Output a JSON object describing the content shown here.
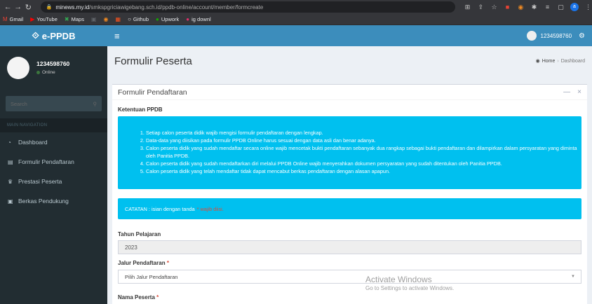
{
  "browser": {
    "url_host": "minews.my.id",
    "url_path": "/smkspgriciawigebang.sch.id/ppdb-online/account/member/formcreate",
    "bookmarks": [
      {
        "label": "Gmail",
        "icon": "M",
        "color": "#ea4335"
      },
      {
        "label": "YouTube",
        "icon": "▶",
        "color": "#ff0000"
      },
      {
        "label": "Maps",
        "icon": "✖",
        "color": "#34a853"
      },
      {
        "label": "",
        "icon": "▣",
        "color": "#5f6368"
      },
      {
        "label": "",
        "icon": "◉",
        "color": "#f28b22"
      },
      {
        "label": "",
        "icon": "▦",
        "color": "#f4511e"
      },
      {
        "label": "Github",
        "icon": "○",
        "color": "#e8eaed"
      },
      {
        "label": "Upwork",
        "icon": "●",
        "color": "#14a800"
      },
      {
        "label": "ig downl",
        "icon": "●",
        "color": "#e1306c"
      }
    ]
  },
  "app": {
    "logo": "e-PPDB",
    "user_id": "1234598760",
    "status": "Online",
    "search_placeholder": "Search",
    "nav_header": "MAIN NAVIGATION",
    "nav_items": [
      {
        "label": "Dashboard",
        "icon": "dashboard-icon"
      },
      {
        "label": "Formulir Pendaftaran",
        "icon": "file-icon"
      },
      {
        "label": "Prestasi Peserta",
        "icon": "trophy-icon"
      },
      {
        "label": "Berkas Pendukung",
        "icon": "folder-icon"
      }
    ]
  },
  "page": {
    "title": "Formulir Peserta",
    "breadcrumb_home": "Home",
    "breadcrumb_current": "Dashboard"
  },
  "form": {
    "box_title": "Formulir Pendaftaran",
    "rules_title": "Ketentuan PPDB",
    "rules": [
      "Setiap calon peserta didik wajib mengisi formulir pendaftaran dengan lengkap.",
      "Data-data yang diisikan pada formulir PPDB Online harus sesuai dengan data asli dan benar adanya.",
      "Calon peserta didik yang sudah mendaftar secara online wajib mencetak bukti pendaftaran sebanyak dua rangkap sebagai bukti pendaftaran dan dilampirkan dalam persyaratan yang diminta oleh Panitia PPDB.",
      "Calon peserta didik yang sudah mendaftarkan diri melalui PPDB Online wajib menyerahkan dokumen persyaratan yang sudah ditentukan oleh Panitia PPDB.",
      "Calon peserta didik yang telah mendaftar tidak dapat mencabut berkas pendaftaran dengan alasan apapun."
    ],
    "note_prefix": "CATATAN : isian dengan tanda",
    "note_warn": "* wajib diisi.",
    "tahun_label": "Tahun Pelajaran",
    "tahun_value": "2023",
    "jalur_label": "Jalur Pendaftaran",
    "jalur_placeholder": "Pilih Jalur Pendaftaran",
    "nama_label": "Nama Peserta",
    "required_mark": "*"
  },
  "watermark": {
    "line1": "Activate Windows",
    "line2": "Go to Settings to activate Windows."
  }
}
